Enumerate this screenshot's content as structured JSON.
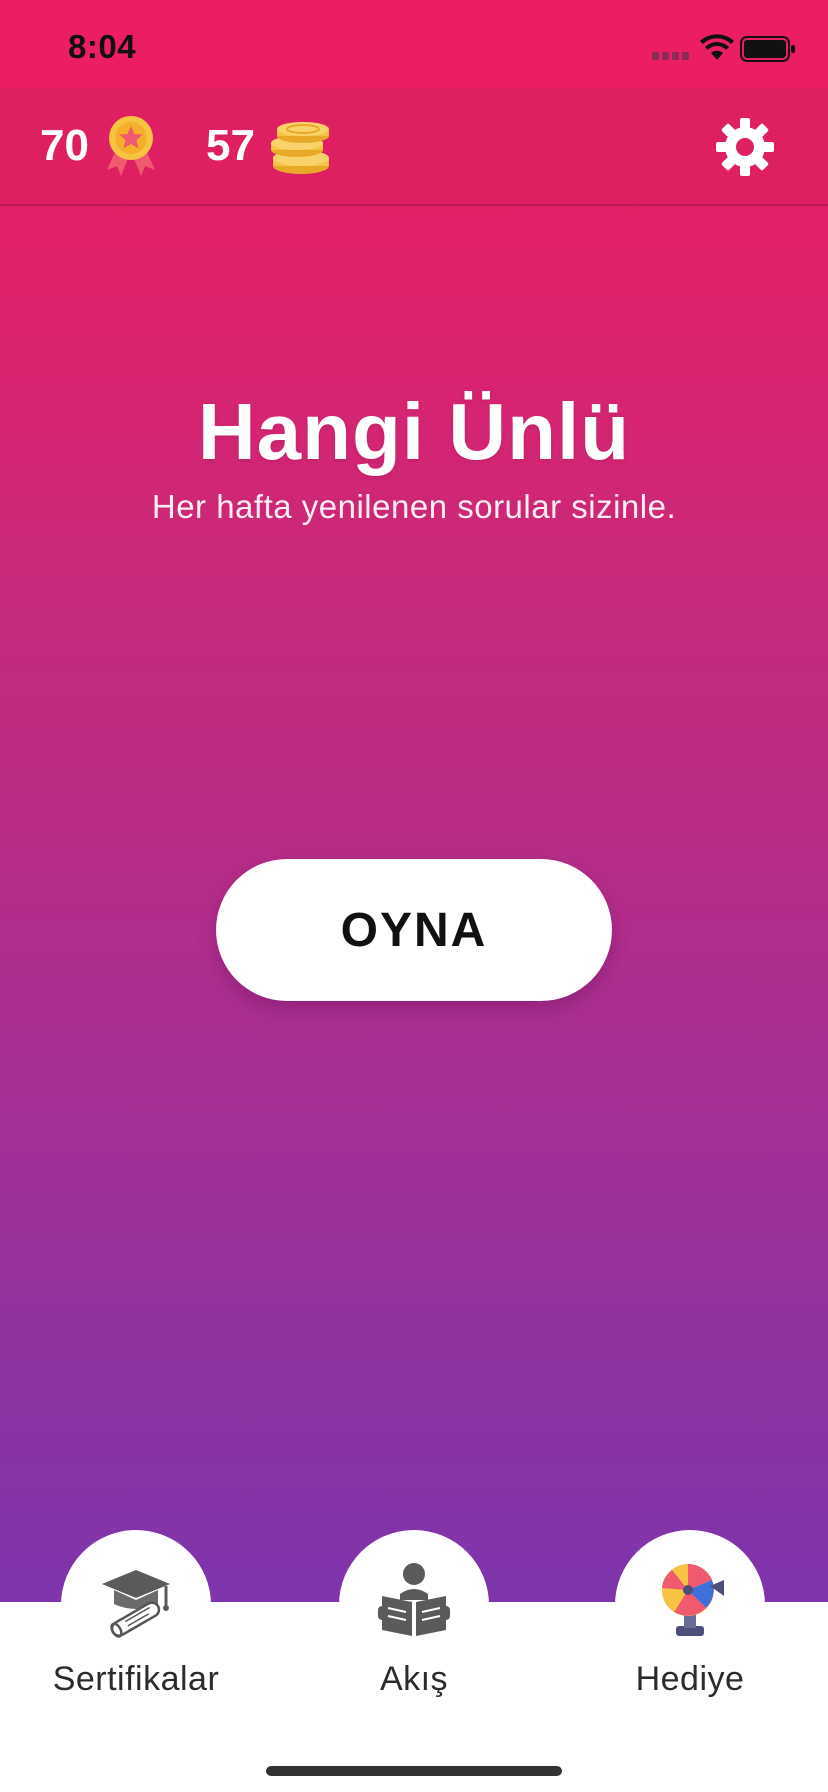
{
  "status_bar": {
    "time": "8:04"
  },
  "header": {
    "points": "70",
    "coins": "57",
    "points_icon": "medal-icon",
    "coins_icon": "coins-icon",
    "settings_icon": "gear-icon"
  },
  "hero": {
    "title": "Hangi Ünlü",
    "subtitle": "Her hafta yenilenen sorular sizinle."
  },
  "play_button": {
    "label": "OYNA"
  },
  "bottom_nav": {
    "items": [
      {
        "label": "Sertifikalar",
        "icon": "graduation-cap-icon"
      },
      {
        "label": "Akış",
        "icon": "reader-icon"
      },
      {
        "label": "Hediye",
        "icon": "prize-wheel-icon"
      }
    ]
  },
  "colors": {
    "gradient_top": "#ec1e63",
    "gradient_bottom": "#7436b4",
    "header_bg": "#de1f62",
    "button_bg": "#ffffff",
    "coin_gold": "#f6c343",
    "medal_red": "#f05a6e"
  }
}
